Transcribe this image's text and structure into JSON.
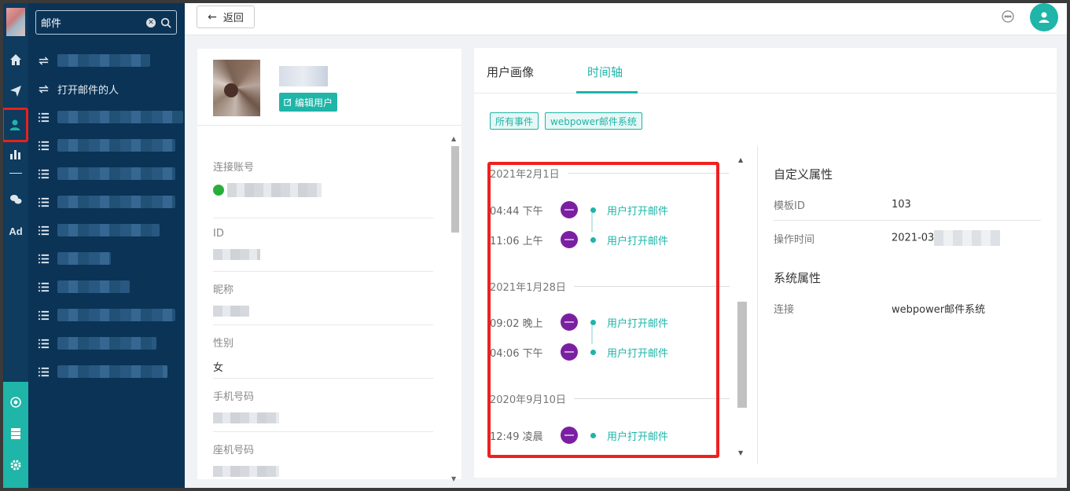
{
  "search": {
    "value": "邮件",
    "clear_icon": "clear-icon",
    "icon": "search-icon"
  },
  "sidebar": {
    "items": [
      {
        "icon": "sync-icon",
        "label": ""
      },
      {
        "icon": "sync-icon",
        "label": "打开邮件的人"
      },
      {
        "icon": "list-icon",
        "label": ""
      },
      {
        "icon": "list-icon",
        "label": ""
      },
      {
        "icon": "list-icon",
        "label": ""
      },
      {
        "icon": "list-icon",
        "label": ""
      },
      {
        "icon": "list-icon",
        "label": ""
      },
      {
        "icon": "list-icon",
        "label": ""
      },
      {
        "icon": "list-icon",
        "label": ""
      },
      {
        "icon": "list-icon",
        "label": ""
      },
      {
        "icon": "list-icon",
        "label": ""
      },
      {
        "icon": "list-icon",
        "label": ""
      }
    ]
  },
  "rail": {
    "ad_label": "Ad"
  },
  "topbar": {
    "back_label": "返回"
  },
  "profile": {
    "edit_label": "编辑用户",
    "fields": [
      {
        "label": "连接账号",
        "value": ""
      },
      {
        "label": "ID",
        "value": ""
      },
      {
        "label": "昵称",
        "value": ""
      },
      {
        "label": "性别",
        "value": "女"
      },
      {
        "label": "手机号码",
        "value": ""
      },
      {
        "label": "座机号码",
        "value": ""
      }
    ]
  },
  "main": {
    "tabs": [
      {
        "label": "用户画像"
      },
      {
        "label": "时间轴"
      }
    ],
    "active_tab": "时间轴",
    "tags": [
      "所有事件",
      "webpower邮件系统"
    ],
    "timeline": [
      {
        "date": "2021年2月1日",
        "events": [
          {
            "time": "04:44 下午",
            "name": "用户打开邮件"
          },
          {
            "time": "11:06 上午",
            "name": "用户打开邮件"
          }
        ]
      },
      {
        "date": "2021年1月28日",
        "events": [
          {
            "time": "09:02 晚上",
            "name": "用户打开邮件"
          },
          {
            "time": "04:06 下午",
            "name": "用户打开邮件"
          }
        ]
      },
      {
        "date": "2020年9月10日",
        "events": [
          {
            "time": "12:49 凌晨",
            "name": "用户打开邮件"
          }
        ]
      }
    ],
    "custom_attrs": {
      "title": "自定义属性",
      "rows": [
        {
          "key": "模板ID",
          "value": "103"
        },
        {
          "key": "操作时间",
          "value": "2021-03"
        }
      ]
    },
    "system_attrs": {
      "title": "系统属性",
      "rows": [
        {
          "key": "连接",
          "value": "webpower邮件系统"
        }
      ]
    }
  },
  "colors": {
    "accent": "#1fb5a8",
    "nav_bg": "#0a3356",
    "highlight_red": "#f02020",
    "event_logo": "#7b1fa2"
  }
}
